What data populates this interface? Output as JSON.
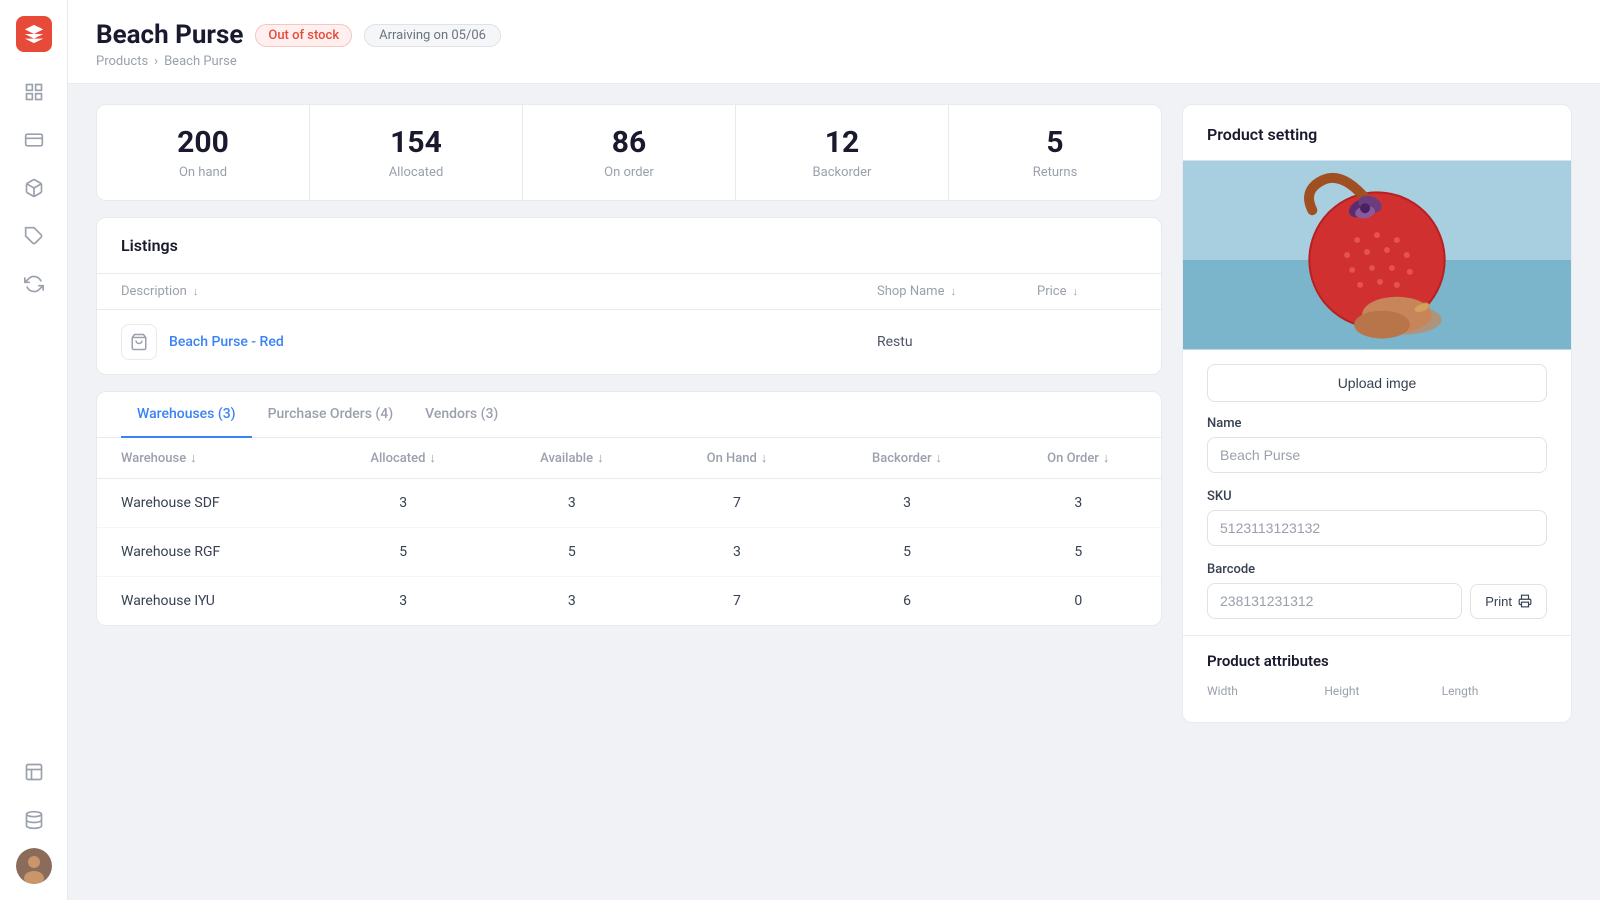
{
  "sidebar": {
    "logo_alt": "App logo",
    "items": [
      {
        "name": "inventory-icon",
        "icon": "⊞",
        "label": "Inventory"
      },
      {
        "name": "billing-icon",
        "icon": "$",
        "label": "Billing"
      },
      {
        "name": "packages-icon",
        "icon": "⬡",
        "label": "Packages"
      },
      {
        "name": "tags-icon",
        "icon": "🏷",
        "label": "Tags"
      },
      {
        "name": "sync-icon",
        "icon": "↻",
        "label": "Sync"
      },
      {
        "name": "pages-icon",
        "icon": "☰",
        "label": "Pages"
      },
      {
        "name": "storage-icon",
        "icon": "▤",
        "label": "Storage"
      }
    ]
  },
  "header": {
    "title": "Beach Purse",
    "badge_out_of_stock": "Out of stock",
    "badge_arriving": "Arraiving on 05/06",
    "breadcrumb_parent": "Products",
    "breadcrumb_current": "Beach Purse"
  },
  "stats": [
    {
      "value": "200",
      "label": "On hand"
    },
    {
      "value": "154",
      "label": "Allocated"
    },
    {
      "value": "86",
      "label": "On order"
    },
    {
      "value": "12",
      "label": "Backorder"
    },
    {
      "value": "5",
      "label": "Returns"
    }
  ],
  "listings": {
    "title": "Listings",
    "columns": {
      "description": "Description",
      "shop_name": "Shop Name",
      "price": "Price"
    },
    "rows": [
      {
        "icon": "🛍",
        "name": "Beach Purse - Red",
        "shop": "Restu",
        "price": ""
      }
    ]
  },
  "tabs": [
    {
      "label": "Warehouses (3)",
      "active": true
    },
    {
      "label": "Purchase Orders (4)",
      "active": false
    },
    {
      "label": "Vendors (3)",
      "active": false
    }
  ],
  "warehouse_table": {
    "columns": [
      "Warehouse",
      "Allocated",
      "Available",
      "On Hand",
      "Backorder",
      "On Order"
    ],
    "rows": [
      {
        "name": "Warehouse SDF",
        "allocated": 3,
        "available": 3,
        "on_hand": 7,
        "backorder": 3,
        "on_order": 3
      },
      {
        "name": "Warehouse RGF",
        "allocated": 5,
        "available": 5,
        "on_hand": 3,
        "backorder": 5,
        "on_order": 5
      },
      {
        "name": "Warehouse IYU",
        "allocated": 3,
        "available": 3,
        "on_hand": 7,
        "backorder": 6,
        "on_order": 0
      }
    ]
  },
  "product_settings": {
    "title": "Product setting",
    "upload_button": "Upload imge",
    "name_label": "Name",
    "name_value": "Beach Purse",
    "sku_label": "SKU",
    "sku_value": "5123113123132",
    "barcode_label": "Barcode",
    "barcode_value": "238131231312",
    "print_button": "Print",
    "attributes_title": "Product attributes",
    "attr_width": "Width",
    "attr_height": "Height",
    "attr_length": "Length"
  }
}
